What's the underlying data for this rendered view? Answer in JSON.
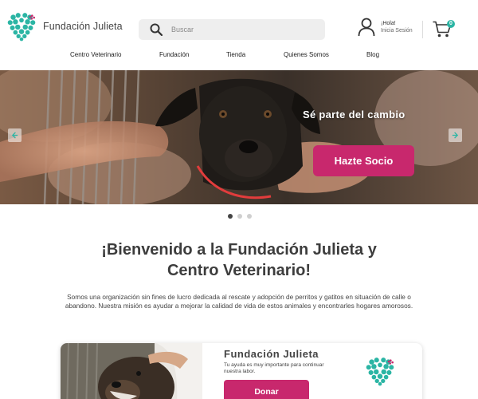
{
  "brand": {
    "name": "Fundación Julieta",
    "icon": "paw-heart-logo",
    "primary_color": "#2bb5a4",
    "accent_color": "#c8286d"
  },
  "search": {
    "placeholder": "Buscar",
    "value": ""
  },
  "account": {
    "greeting": "¡Hola!",
    "login_label": "Inicia Sesión"
  },
  "cart": {
    "count": "0"
  },
  "nav": {
    "items": [
      {
        "label": "Centro Veterinario"
      },
      {
        "label": "Fundación"
      },
      {
        "label": "Tienda"
      },
      {
        "label": "Quienes Somos"
      },
      {
        "label": "Blog"
      }
    ]
  },
  "hero": {
    "tagline": "Sé parte del cambio",
    "cta_label": "Hazte Socio",
    "slide_count": 3,
    "active_slide": 1
  },
  "welcome": {
    "title_line1": "¡Bienvenido a la Fundación Julieta y",
    "title_line2": "Centro Veterinario!",
    "text": "Somos una organización sin fines de lucro dedicada al rescate y adopción de perritos y gatitos en situación de calle o abandono. Nuestra misión es ayudar a mejorar la calidad de vida de estos animales y encontrarles hogares amorosos."
  },
  "donation_card": {
    "title": "Fundación Julieta",
    "subtitle": "Tu ayuda es muy importante para continuar nuestra labor.",
    "button_label": "Donar"
  }
}
